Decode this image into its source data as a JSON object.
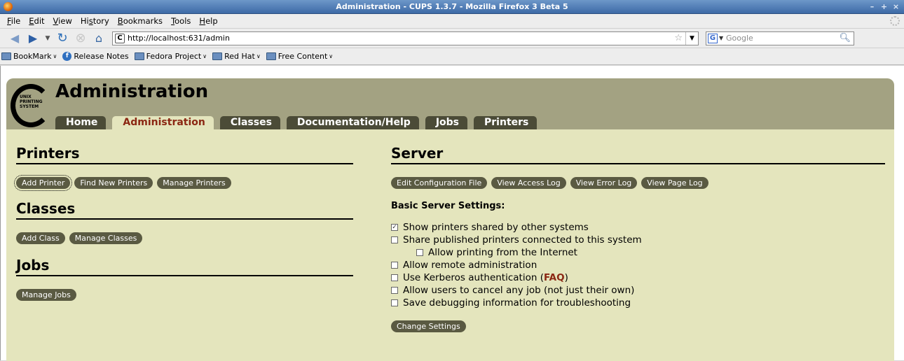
{
  "window": {
    "title": "Administration - CUPS 1.3.7 - Mozilla Firefox 3 Beta 5"
  },
  "menubar": {
    "items": [
      {
        "key": "F",
        "rest": "ile"
      },
      {
        "key": "E",
        "rest": "dit"
      },
      {
        "key": "V",
        "rest": "iew"
      },
      {
        "pre": "Hi",
        "key": "s",
        "rest": "tory"
      },
      {
        "key": "B",
        "rest": "ookmarks"
      },
      {
        "key": "T",
        "rest": "ools"
      },
      {
        "key": "H",
        "rest": "elp"
      }
    ]
  },
  "navbar": {
    "url": "http://localhost:631/admin",
    "search_placeholder": "Google"
  },
  "bookmarks": {
    "items": [
      "BookMark",
      "Release Notes",
      "Fedora Project",
      "Red Hat",
      "Free Content"
    ]
  },
  "cups": {
    "title": "Administration",
    "logo_text": [
      "UNIX",
      "PRINTING",
      "SYSTEM"
    ],
    "tabs": [
      "Home",
      "Administration",
      "Classes",
      "Documentation/Help",
      "Jobs",
      "Printers"
    ],
    "printers": {
      "heading": "Printers",
      "buttons": [
        "Add Printer",
        "Find New Printers",
        "Manage Printers"
      ]
    },
    "classes": {
      "heading": "Classes",
      "buttons": [
        "Add Class",
        "Manage Classes"
      ]
    },
    "jobs": {
      "heading": "Jobs",
      "buttons": [
        "Manage Jobs"
      ]
    },
    "server": {
      "heading": "Server",
      "buttons": [
        "Edit Configuration File",
        "View Access Log",
        "View Error Log",
        "View Page Log"
      ],
      "settings_heading": "Basic Server Settings:",
      "settings": [
        {
          "label": "Show printers shared by other systems",
          "checked": true
        },
        {
          "label": "Share published printers connected to this system",
          "checked": false
        },
        {
          "label": "Allow printing from the Internet",
          "checked": false
        },
        {
          "label": "Allow remote administration",
          "checked": false
        },
        {
          "label": "Use Kerberos authentication (",
          "link": "FAQ",
          "suffix": ")",
          "checked": false
        },
        {
          "label": "Allow users to cancel any job (not just their own)",
          "checked": false
        },
        {
          "label": "Save debugging information for troubleshooting",
          "checked": false
        }
      ],
      "submit": "Change Settings"
    }
  }
}
